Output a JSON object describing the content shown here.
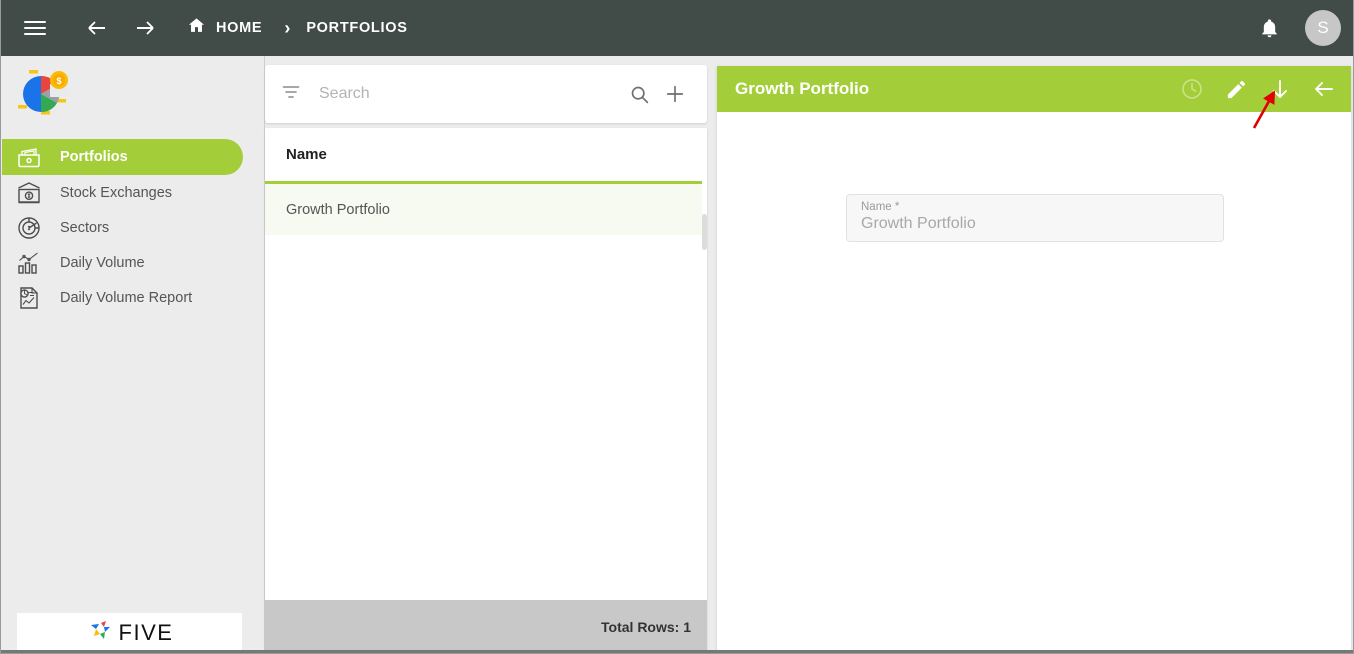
{
  "topbar": {
    "menu_icon": "hamburger-menu-icon",
    "back_icon": "arrow-left-icon",
    "forward_icon": "arrow-right-icon",
    "home_icon": "home-icon",
    "home_label": "HOME",
    "separator": "›",
    "current_label": "PORTFOLIOS",
    "notification_icon": "bell-icon",
    "avatar_initial": "S",
    "bg_color": "#414b47"
  },
  "sidebar": {
    "logo_name": "app-logo-pie-chart-coin",
    "items": [
      {
        "label": "Portfolios",
        "icon": "wallet-money-icon",
        "active": true
      },
      {
        "label": "Stock Exchanges",
        "icon": "bank-icon",
        "active": false
      },
      {
        "label": "Sectors",
        "icon": "pie-chart-dollar-icon",
        "active": false
      },
      {
        "label": "Daily Volume",
        "icon": "bar-chart-icon",
        "active": false
      },
      {
        "label": "Daily Volume Report",
        "icon": "report-document-icon",
        "active": false
      }
    ],
    "footer_logo": "FIVE",
    "active_color": "#a4ce39"
  },
  "list_panel": {
    "search": {
      "placeholder": "Search",
      "value": "",
      "filter_icon": "filter-icon",
      "search_icon": "search-icon",
      "add_icon": "plus-icon"
    },
    "columns": [
      "Name"
    ],
    "rows": [
      {
        "name": "Growth Portfolio",
        "selected": true
      }
    ],
    "footer_text": "Total Rows: 1"
  },
  "detail_panel": {
    "title": "Growth Portfolio",
    "actions": [
      {
        "name": "history-clock-icon",
        "label": "History"
      },
      {
        "name": "pencil-edit-icon",
        "label": "Edit"
      },
      {
        "name": "arrow-down-icon",
        "label": "Download"
      },
      {
        "name": "arrow-left-icon",
        "label": "Back"
      }
    ],
    "fields": [
      {
        "label": "Name *",
        "value": "Growth Portfolio"
      }
    ],
    "header_color": "#a4ce39"
  },
  "annotation": {
    "type": "red-arrow",
    "color": "#e00000",
    "points_to": "arrow-down-icon"
  }
}
